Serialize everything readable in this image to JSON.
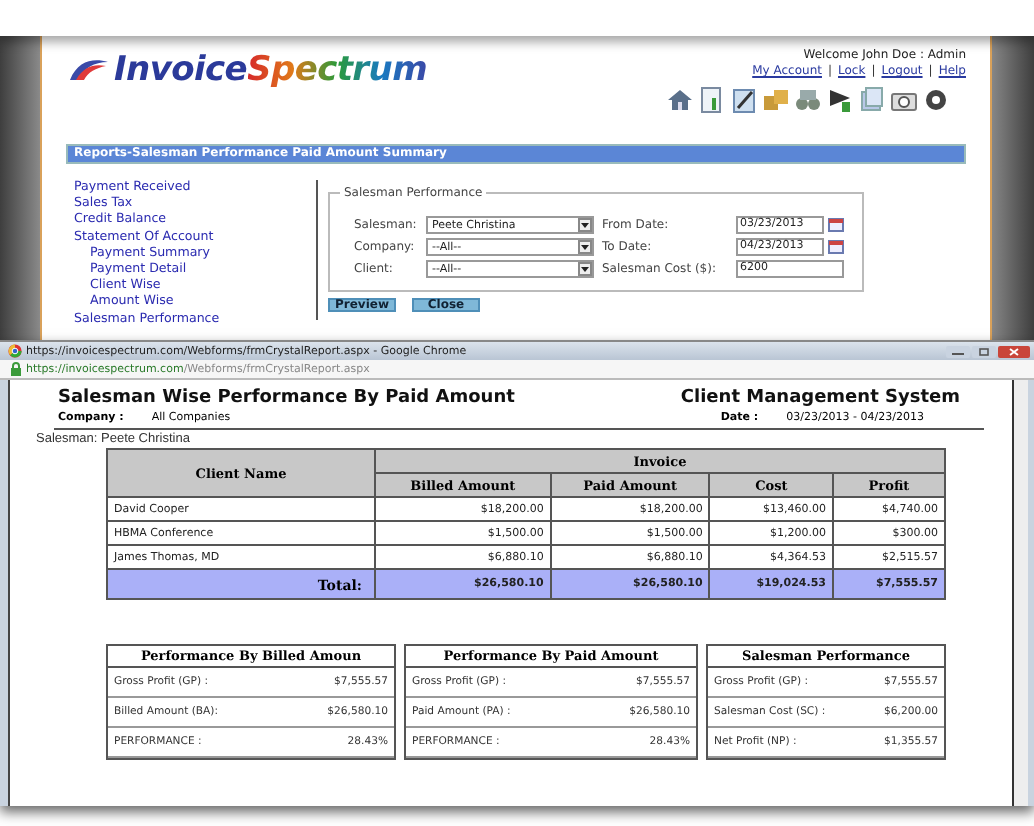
{
  "header": {
    "logo": {
      "first": "Invoice",
      "second": "Spectrum"
    },
    "welcome": "Welcome John Doe : Admin",
    "link_separator": "|",
    "links": [
      "My Account",
      "Lock",
      "Logout",
      "Help"
    ]
  },
  "page_title": "Reports-Salesman Performance Paid Amount Summary",
  "sidebar": {
    "items": [
      {
        "label": "Payment Received"
      },
      {
        "label": "Sales Tax"
      },
      {
        "label": "Credit Balance"
      },
      {
        "label": "Statement Of Account",
        "children": [
          {
            "label": "Payment Summary"
          },
          {
            "label": "Payment Detail"
          },
          {
            "label": "Client Wise"
          },
          {
            "label": "Amount Wise"
          }
        ]
      },
      {
        "label": "Salesman Performance"
      }
    ]
  },
  "form": {
    "legend": "Salesman Performance",
    "columns": [
      [
        {
          "label": "Salesman:",
          "kind": "select",
          "value": "Peete Christina"
        },
        {
          "label": "Company:",
          "kind": "select",
          "value": "--All--"
        },
        {
          "label": "Client:",
          "kind": "select",
          "value": "--All--"
        }
      ],
      [
        {
          "label": "From Date:",
          "kind": "date",
          "value": "03/23/2013"
        },
        {
          "label": "To Date:",
          "kind": "date",
          "value": "04/23/2013"
        },
        {
          "label": "Salesman Cost ($):",
          "kind": "text",
          "value": "6200"
        }
      ]
    ],
    "buttons": [
      "Preview",
      "Close"
    ]
  },
  "popup": {
    "title": "https://invoicespectrum.com/Webforms/frmCrystalReport.aspx - Google Chrome",
    "url_host": "https://invoicespectrum.com",
    "url_path": "/Webforms/frmCrystalReport.aspx",
    "report": {
      "title": "Salesman Wise Performance By Paid Amount",
      "system": "Client Management System",
      "company_label": "Company :",
      "company": "All Companies",
      "date_label": "Date :",
      "date": "03/23/2013 - 04/23/2013",
      "salesman": "Salesman: Peete Christina",
      "table": {
        "name_column": "Client Name",
        "group": "Invoice",
        "columns": [
          "Billed Amount",
          "Paid Amount",
          "Cost",
          "Profit"
        ],
        "rows": [
          {
            "name": "David Cooper",
            "values": [
              "$18,200.00",
              "$18,200.00",
              "$13,460.00",
              "$4,740.00"
            ]
          },
          {
            "name": "HBMA Conference",
            "values": [
              "$1,500.00",
              "$1,500.00",
              "$1,200.00",
              "$300.00"
            ]
          },
          {
            "name": "James Thomas, MD",
            "values": [
              "$6,880.10",
              "$6,880.10",
              "$4,364.53",
              "$2,515.57"
            ]
          }
        ],
        "total_label": "Total:",
        "totals": [
          "$26,580.10",
          "$26,580.10",
          "$19,024.53",
          "$7,555.57"
        ]
      },
      "panels": [
        {
          "title": "Performance By Billed Amoun",
          "rows": [
            [
              "Gross Profit (GP)  :",
              "$7,555.57"
            ],
            [
              "Billed Amount (BA):",
              "$26,580.10"
            ],
            [
              "PERFORMANCE :",
              "28.43%"
            ]
          ]
        },
        {
          "title": "Performance By Paid Amount",
          "rows": [
            [
              "Gross Profit (GP)  :",
              "$7,555.57"
            ],
            [
              "Paid Amount (PA) :",
              "$26,580.10"
            ],
            [
              "PERFORMANCE :",
              "28.43%"
            ]
          ]
        },
        {
          "title": "Salesman Performance",
          "rows": [
            [
              "Gross Profit (GP) :",
              "$7,555.57"
            ],
            [
              "Salesman Cost (SC) :",
              "$6,200.00"
            ],
            [
              "Net Profit (NP) :",
              "$1,355.57"
            ]
          ]
        }
      ]
    }
  }
}
